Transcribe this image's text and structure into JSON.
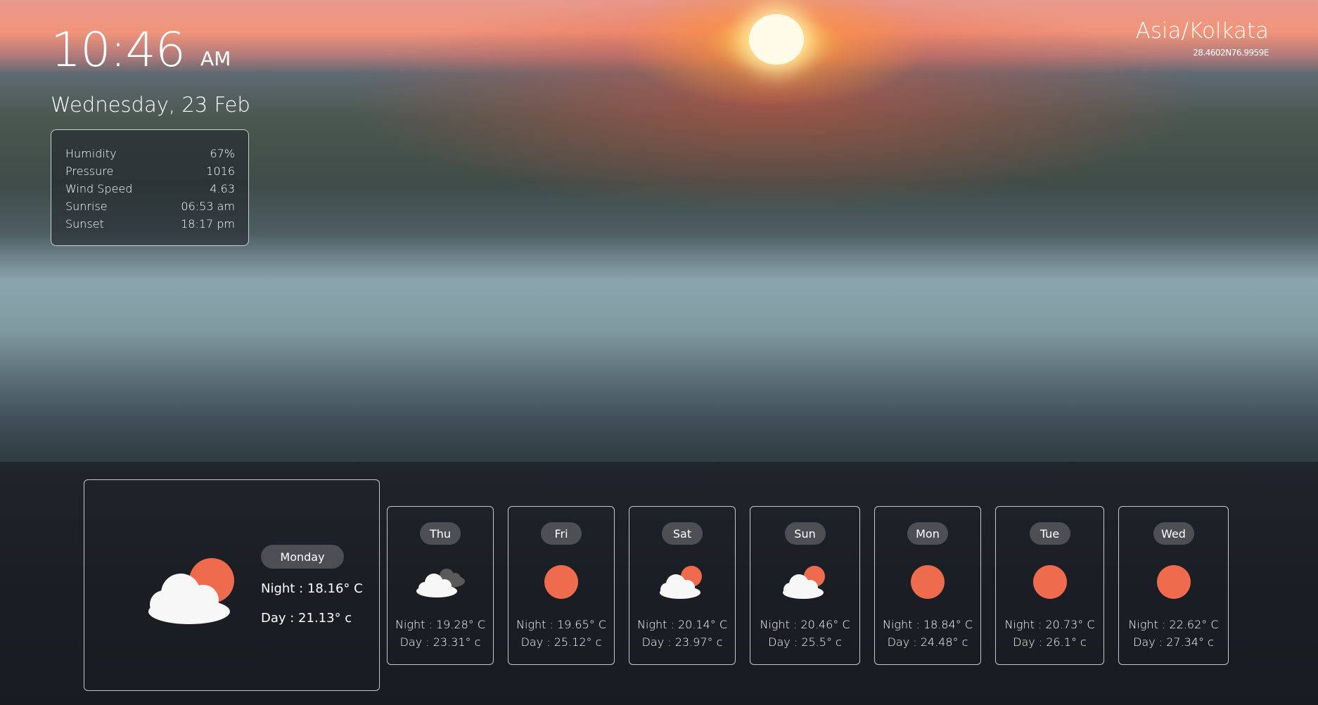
{
  "clock": {
    "time": "10:46",
    "ampm": "AM",
    "date": "Wednesday, 23 Feb"
  },
  "location": {
    "timezone": "Asia/Kolkata",
    "coords": "28.4602N76.9959E"
  },
  "details": [
    {
      "label": "Humidity",
      "value": "67%"
    },
    {
      "label": "Pressure",
      "value": "1016"
    },
    {
      "label": "Wind Speed",
      "value": "4.63"
    },
    {
      "label": "Sunrise",
      "value": "06:53 am"
    },
    {
      "label": "Sunset",
      "value": "18:17 pm"
    }
  ],
  "today": {
    "day": "Monday",
    "night": "Night : 18.16° C",
    "dayTemp": "Day : 21.13° c",
    "icon": "cloud-sun-icon"
  },
  "forecast": [
    {
      "day": "Thu",
      "night": "Night : 19.28° C",
      "dayTemp": "Day : 23.31° c",
      "icon": "cloudy-icon"
    },
    {
      "day": "Fri",
      "night": "Night : 19.65° C",
      "dayTemp": "Day : 25.12° c",
      "icon": "sun-icon"
    },
    {
      "day": "Sat",
      "night": "Night : 20.14° C",
      "dayTemp": "Day : 23.97° c",
      "icon": "cloud-sun-icon"
    },
    {
      "day": "Sun",
      "night": "Night : 20.46° C",
      "dayTemp": "Day : 25.5° c",
      "icon": "cloud-sun-icon"
    },
    {
      "day": "Mon",
      "night": "Night : 18.84° C",
      "dayTemp": "Day : 24.48° c",
      "icon": "sun-icon"
    },
    {
      "day": "Tue",
      "night": "Night : 20.73° C",
      "dayTemp": "Day : 26.1° c",
      "icon": "sun-icon"
    },
    {
      "day": "Wed",
      "night": "Night : 22.62° C",
      "dayTemp": "Day : 27.34° c",
      "icon": "sun-icon"
    }
  ],
  "colors": {
    "sun": "#ee6c4d",
    "cloud": "#f7f7f7",
    "darkCloud": "#5a5a5a"
  }
}
